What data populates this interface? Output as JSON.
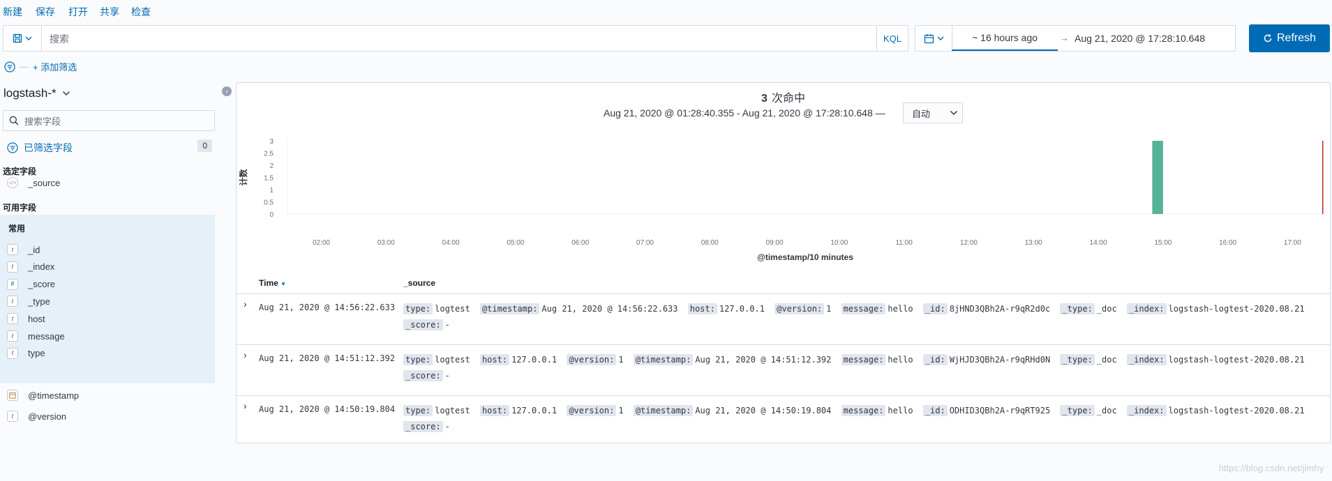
{
  "topmenu": [
    "新建",
    "保存",
    "打开",
    "共享",
    "检查"
  ],
  "query": {
    "placeholder": "搜索",
    "language": "KQL"
  },
  "time": {
    "start": "~ 16 hours ago",
    "arrow": "→",
    "end": "Aug 21, 2020 @ 17:28:10.648"
  },
  "refresh_label": "Refresh",
  "filter": {
    "add_label": "+ 添加筛选",
    "dash": "—"
  },
  "sidebar": {
    "index_pattern": "logstash-*",
    "search_placeholder": "搜索字段",
    "filtered_fields_label": "已筛选字段",
    "filtered_count": "0",
    "selected_label": "选定字段",
    "selected_fields": [
      {
        "icon": "</>",
        "name": "_source"
      }
    ],
    "available_label": "可用字段",
    "common_label": "常用",
    "common_fields": [
      {
        "icon": "t",
        "name": "_id"
      },
      {
        "icon": "t",
        "name": "_index"
      },
      {
        "icon": "#",
        "name": "_score"
      },
      {
        "icon": "t",
        "name": "_type"
      },
      {
        "icon": "t",
        "name": "host"
      },
      {
        "icon": "t",
        "name": "message"
      },
      {
        "icon": "t",
        "name": "type"
      }
    ],
    "other_fields": [
      {
        "icon": "cal",
        "name": "@timestamp"
      },
      {
        "icon": "t",
        "name": "@version"
      }
    ]
  },
  "hits": {
    "count": "3",
    "label": "次命中"
  },
  "range_text": "Aug 21, 2020 @ 01:28:40.355 - Aug 21, 2020 @ 17:28:10.648 —",
  "interval": "自动",
  "chart_data": {
    "type": "bar",
    "ylabel": "计数",
    "xlabel": "@timestamp/10 minutes",
    "y_ticks": [
      "0",
      "0.5",
      "1",
      "1.5",
      "2",
      "2.5",
      "3"
    ],
    "x_ticks": [
      "02:00",
      "03:00",
      "04:00",
      "05:00",
      "06:00",
      "07:00",
      "08:00",
      "09:00",
      "10:00",
      "11:00",
      "12:00",
      "13:00",
      "14:00",
      "15:00",
      "16:00",
      "17:00"
    ],
    "ylim": [
      0,
      3
    ],
    "bars": [
      {
        "x": "14:50",
        "value": 3
      }
    ],
    "current_time_marker": "17:28",
    "colors": {
      "bar": "#54b399",
      "marker": "#bd271e"
    }
  },
  "table": {
    "headers": [
      "Time",
      "_source"
    ],
    "rows": [
      {
        "time": "Aug 21, 2020 @ 14:56:22.633",
        "source": [
          [
            "type:",
            "logtest"
          ],
          [
            "@timestamp:",
            "Aug 21, 2020 @ 14:56:22.633"
          ],
          [
            "host:",
            "127.0.0.1"
          ],
          [
            "@version:",
            "1"
          ],
          [
            "message:",
            "hello"
          ],
          [
            "_id:",
            "8jHND3QBh2A-r9qR2d0c"
          ],
          [
            "_type:",
            "_doc"
          ],
          [
            "_index:",
            "logstash-logtest-2020.08.21"
          ],
          [
            "_score:",
            "-"
          ]
        ]
      },
      {
        "time": "Aug 21, 2020 @ 14:51:12.392",
        "source": [
          [
            "type:",
            "logtest"
          ],
          [
            "host:",
            "127.0.0.1"
          ],
          [
            "@version:",
            "1"
          ],
          [
            "@timestamp:",
            "Aug 21, 2020 @ 14:51:12.392"
          ],
          [
            "message:",
            "hello"
          ],
          [
            "_id:",
            "WjHJD3QBh2A-r9qRHd0N"
          ],
          [
            "_type:",
            "_doc"
          ],
          [
            "_index:",
            "logstash-logtest-2020.08.21"
          ],
          [
            "_score:",
            "-"
          ]
        ]
      },
      {
        "time": "Aug 21, 2020 @ 14:50:19.804",
        "source": [
          [
            "type:",
            "logtest"
          ],
          [
            "host:",
            "127.0.0.1"
          ],
          [
            "@version:",
            "1"
          ],
          [
            "@timestamp:",
            "Aug 21, 2020 @ 14:50:19.804"
          ],
          [
            "message:",
            "hello"
          ],
          [
            "_id:",
            "ODHID3QBh2A-r9qRT925"
          ],
          [
            "_type:",
            "_doc"
          ],
          [
            "_index:",
            "logstash-logtest-2020.08.21"
          ],
          [
            "_score:",
            "-"
          ]
        ]
      }
    ]
  },
  "watermark": "https://blog.csdn.net/jimhy"
}
